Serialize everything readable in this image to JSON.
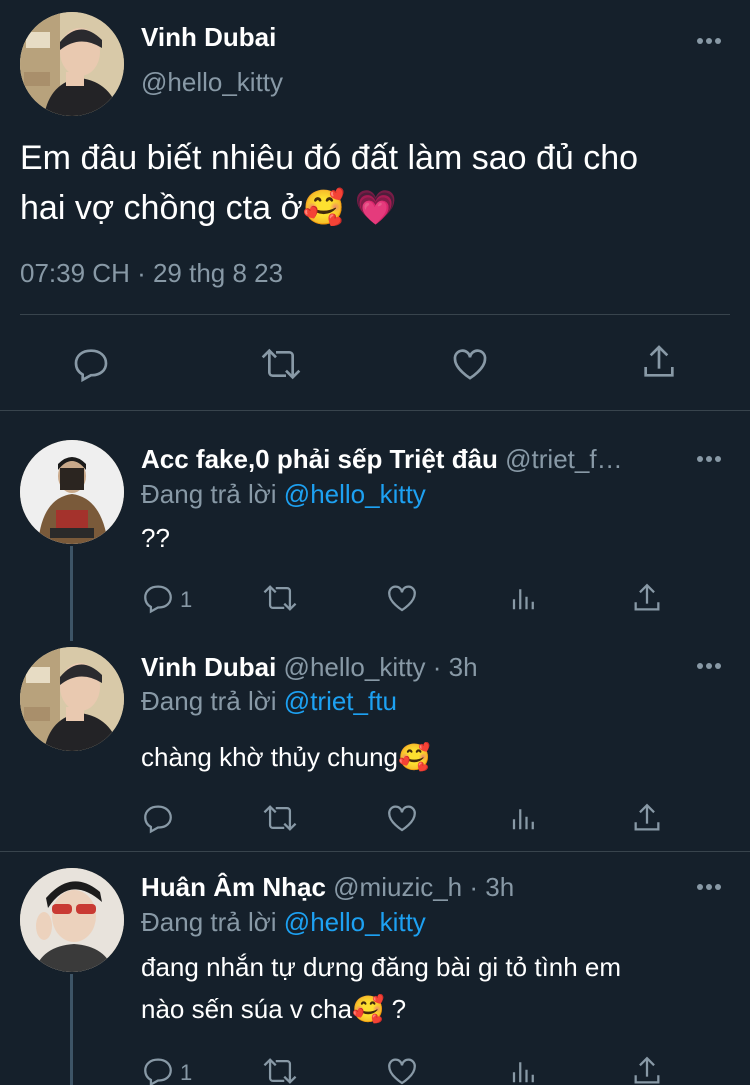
{
  "main_tweet": {
    "name": "Vinh Dubai",
    "handle": "@hello_kitty",
    "text_line1": "Em đâu biết nhiêu đó đất làm sao đủ cho",
    "text_line2": "hai vợ chồng cta ở🥰 💗",
    "timestamp": "07:39 CH · 29 thg 8 23",
    "actions": [
      "reply-icon",
      "retweet-icon",
      "like-icon",
      "share-icon"
    ]
  },
  "replies": [
    {
      "name": "Acc fake,0 phải sếp Triệt đâu",
      "handle": "@triet_f…",
      "time": "",
      "replying_prefix": "Đang trả lời",
      "replying_to": "@hello_kitty",
      "text": "??",
      "reply_count": "1"
    },
    {
      "name": "Vinh Dubai",
      "handle": "@hello_kitty · 3h",
      "time": "",
      "replying_prefix": "Đang trả lời",
      "replying_to": "@triet_ftu",
      "text": "chàng khờ thủy chung🥰",
      "reply_count": ""
    },
    {
      "name": "Huân Âm Nhạc",
      "handle": "@miuzic_h · 3h",
      "time": "",
      "replying_prefix": "Đang trả lời",
      "replying_to": "@hello_kitty",
      "text_line1": "đang nhắn tự dưng đăng bài gi tỏ tình em",
      "text_line2": "nào sến súa v cha🥰 ?",
      "reply_count": "1"
    }
  ],
  "colors": {
    "background": "#15202b",
    "secondary_text": "#8899a6",
    "link": "#1da1f2",
    "divider": "#38444d"
  }
}
